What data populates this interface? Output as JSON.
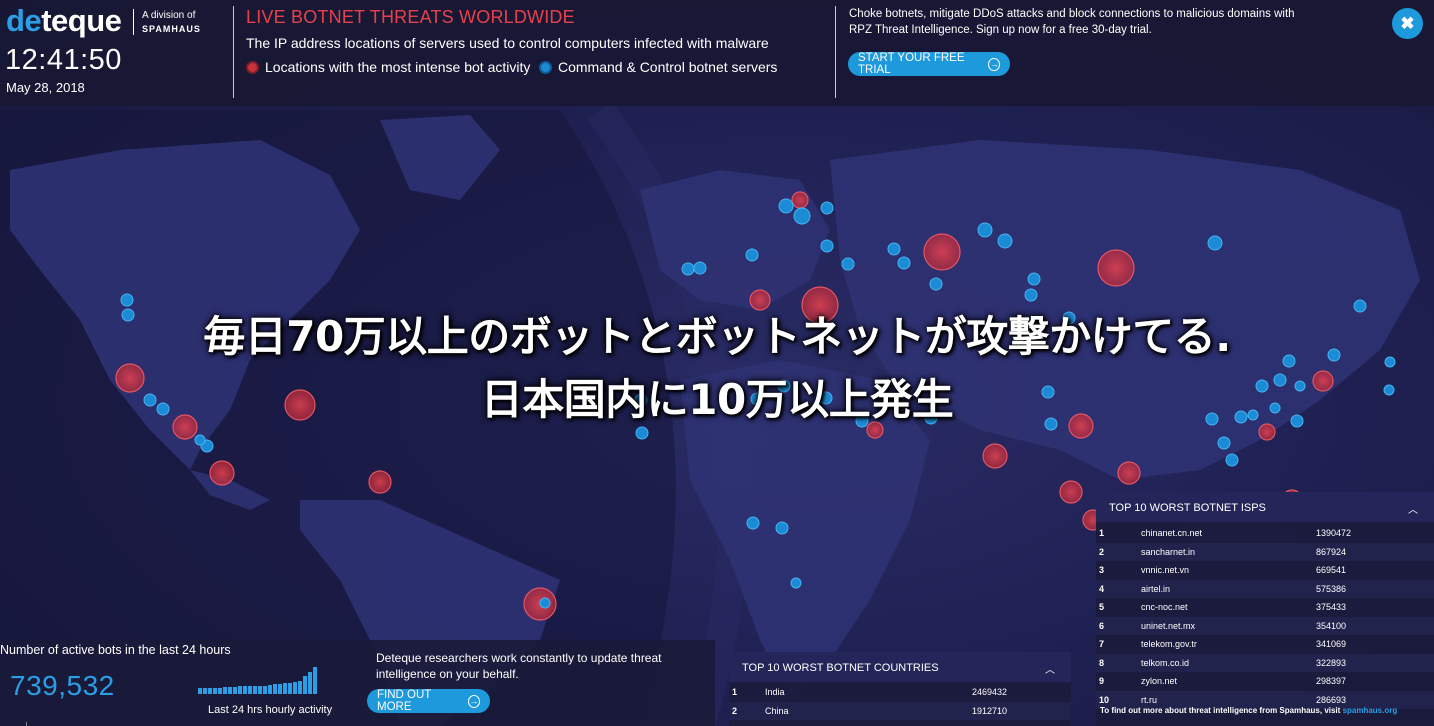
{
  "brand": {
    "logo_prefix": "de",
    "logo_suffix": "teque",
    "division_line": "A division of",
    "division_name": "SPAMHAUS"
  },
  "clock": {
    "time": "12:41:50",
    "date": "May 28, 2018"
  },
  "header": {
    "headline": "LIVE BOTNET THREATS WORLDWIDE",
    "subline": "The IP address locations of servers used to control computers infected with malware",
    "legend_red": "Locations with the most intense bot activity",
    "legend_blue": "Command & Control botnet servers"
  },
  "promo": {
    "text": "Choke botnets, mitigate DDoS attacks and block connections to malicious domains with RPZ Threat Intelligence. Sign up now for a free 30-day trial.",
    "button_label": "START YOUR FREE TRIAL"
  },
  "close_button": {
    "label": "✖"
  },
  "caption": {
    "line1": "毎日70万以上のボットとボットネットが攻撃かけてる.",
    "line2": "日本国内に10万以上発生"
  },
  "stats": {
    "title": "Number of active bots in the last 24 hours",
    "value": "739,532",
    "chart_label": "Last 24 hrs hourly activity",
    "hourly_bars": [
      0.22,
      0.22,
      0.22,
      0.22,
      0.22,
      0.25,
      0.25,
      0.25,
      0.28,
      0.28,
      0.28,
      0.3,
      0.3,
      0.3,
      0.32,
      0.35,
      0.35,
      0.38,
      0.4,
      0.42,
      0.45,
      0.65,
      0.8,
      0.98
    ]
  },
  "research": {
    "text": "Deteque researchers work constantly to update threat intelligence on your behalf.",
    "button_label": "FIND OUT MORE"
  },
  "countries": {
    "title": "TOP 10 WORST BOTNET COUNTRIES",
    "rows": [
      {
        "rank": "1",
        "name": "India",
        "value": "2469432"
      },
      {
        "rank": "2",
        "name": "China",
        "value": "1912710"
      }
    ]
  },
  "isps": {
    "title": "TOP 10 WORST BOTNET ISPS",
    "rows": [
      {
        "rank": "1",
        "name": "chinanet.cn.net",
        "value": "1390472"
      },
      {
        "rank": "2",
        "name": "sancharnet.in",
        "value": "867924"
      },
      {
        "rank": "3",
        "name": "vnnic.net.vn",
        "value": "669541"
      },
      {
        "rank": "4",
        "name": "airtel.in",
        "value": "575386"
      },
      {
        "rank": "5",
        "name": "cnc-noc.net",
        "value": "375433"
      },
      {
        "rank": "6",
        "name": "uninet.net.mx",
        "value": "354100"
      },
      {
        "rank": "7",
        "name": "telekom.gov.tr",
        "value": "341069"
      },
      {
        "rank": "8",
        "name": "telkom.co.id",
        "value": "322893"
      },
      {
        "rank": "9",
        "name": "zylon.net",
        "value": "298397"
      },
      {
        "rank": "10",
        "name": "rt.ru",
        "value": "286693"
      }
    ],
    "footer_text": "To find out more about threat intelligence from Spamhaus, visit",
    "footer_link": "spamhaus.org"
  },
  "colors": {
    "accent_blue": "#1d99dc",
    "headline_red": "#e8404b",
    "bot_red": "#c8323d",
    "cc_blue": "#1c8bd6"
  },
  "icons": {
    "close": "close-icon",
    "arrow": "arrow-right-circle-icon",
    "collapse": "chevron-up-icon"
  }
}
